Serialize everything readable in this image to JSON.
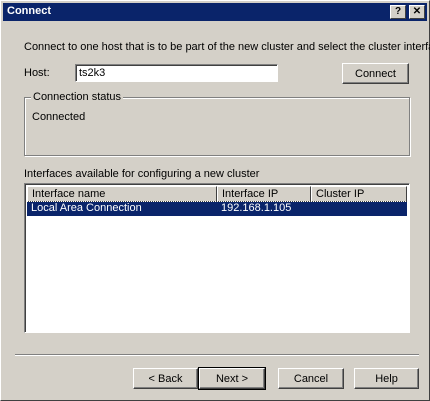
{
  "window": {
    "title": "Connect"
  },
  "titlebar_buttons": {
    "help": "?",
    "close": "✕"
  },
  "instruction": "Connect to one host that is to be part of the new cluster and select the cluster interface",
  "host": {
    "label": "Host:",
    "value": "ts2k3"
  },
  "connect_button": "Connect",
  "connection_status": {
    "title": "Connection status",
    "text": "Connected"
  },
  "interfaces": {
    "label": "Interfaces available for configuring a new cluster",
    "columns": [
      "Interface name",
      "Interface IP",
      "Cluster IP"
    ],
    "rows": [
      {
        "name": "Local Area Connection",
        "ip": "192.168.1.105",
        "cluster_ip": ""
      }
    ]
  },
  "buttons": {
    "back": "< Back",
    "next": "Next >",
    "cancel": "Cancel",
    "help": "Help"
  },
  "colors": {
    "face": "#d4d0c8",
    "title_bar": "#0a246a",
    "selection": "#0a246a"
  }
}
